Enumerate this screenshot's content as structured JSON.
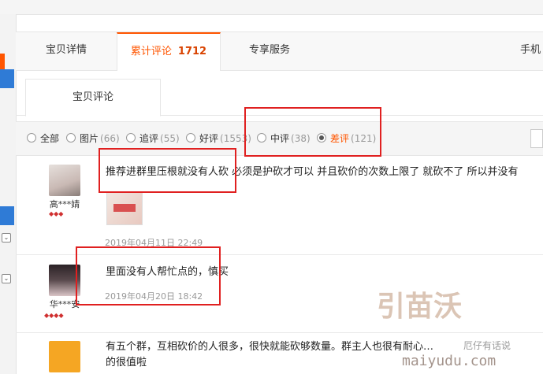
{
  "tabs": [
    {
      "label": "宝贝详情"
    },
    {
      "label": "累计评论",
      "count": "1712"
    },
    {
      "label": "专享服务"
    },
    {
      "label": "手机"
    }
  ],
  "subtab": {
    "label": "宝贝评论"
  },
  "filters": [
    {
      "label": "全部",
      "count": ""
    },
    {
      "label": "图片",
      "count": "(66)"
    },
    {
      "label": "追评",
      "count": "(55)"
    },
    {
      "label": "好评",
      "count": "(1553)"
    },
    {
      "label": "中评",
      "count": "(38)"
    },
    {
      "label": "差评",
      "count": "(121)"
    }
  ],
  "reviews": [
    {
      "user": "高***婧",
      "text": "推荐进群里压根就没有人砍  必须是护砍才可以 并且砍价的次数上限了 就砍不了 所以并没有",
      "date": "2019年04月11日 22:49"
    },
    {
      "user": "华***安",
      "text": "里面没有人帮忙点的，慎买",
      "date": "2019年04月20日 18:42"
    },
    {
      "user": "",
      "text": "有五个群，互相砍价的人很多，很快就能砍够数量。群主人也很有耐心…",
      "text2": "的很值啦",
      "date": ""
    }
  ],
  "watermark": {
    "brand": "引苗沃",
    "site": "maiyudu.com",
    "channel": "厄仔有话说"
  },
  "colors": {
    "accent": "#ff5500",
    "annotation": "#e02020"
  }
}
